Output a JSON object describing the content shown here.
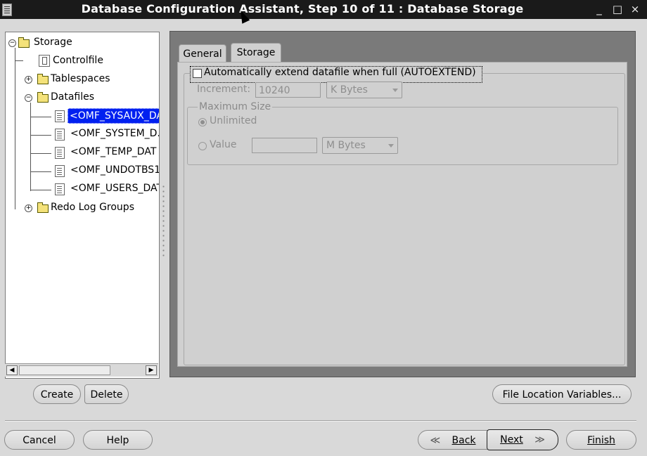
{
  "window": {
    "title": "Database Configuration Assistant, Step 10 of 11 : Database Storage",
    "minimize": "_",
    "maximize": "□",
    "close": "×"
  },
  "tree": {
    "root": "Storage",
    "items": [
      {
        "label": "Controlfile",
        "icon": "controlfile-icon"
      },
      {
        "label": "Tablespaces",
        "icon": "folder-icon"
      },
      {
        "label": "Datafiles",
        "icon": "folder-icon"
      },
      {
        "label": "Redo Log Groups",
        "icon": "folder-icon"
      }
    ],
    "datafiles": [
      "<OMF_SYSAUX_DA",
      "<OMF_SYSTEM_D.",
      "<OMF_TEMP_DAT",
      "<OMF_UNDOTBS1",
      "<OMF_USERS_DAT"
    ],
    "selected": "<OMF_SYSAUX_DA"
  },
  "tabs": [
    {
      "label": "General",
      "active": false
    },
    {
      "label": "Storage",
      "active": true
    }
  ],
  "storage": {
    "autoextend_label": "Automatically extend datafile when full (AUTOEXTEND)",
    "autoextend_checked": false,
    "increment_label": "Increment:",
    "increment_value": "10240",
    "increment_unit": "K Bytes",
    "max_size_legend": "Maximum Size",
    "unlimited_label": "Unlimited",
    "value_label": "Value",
    "value_value": "",
    "value_unit": "M Bytes"
  },
  "buttons": {
    "create": "Create",
    "delete": "Delete",
    "file_location_variables": "File Location Variables...",
    "cancel": "Cancel",
    "help": "Help",
    "back": "Back",
    "next": "Next",
    "finish": "Finish"
  }
}
